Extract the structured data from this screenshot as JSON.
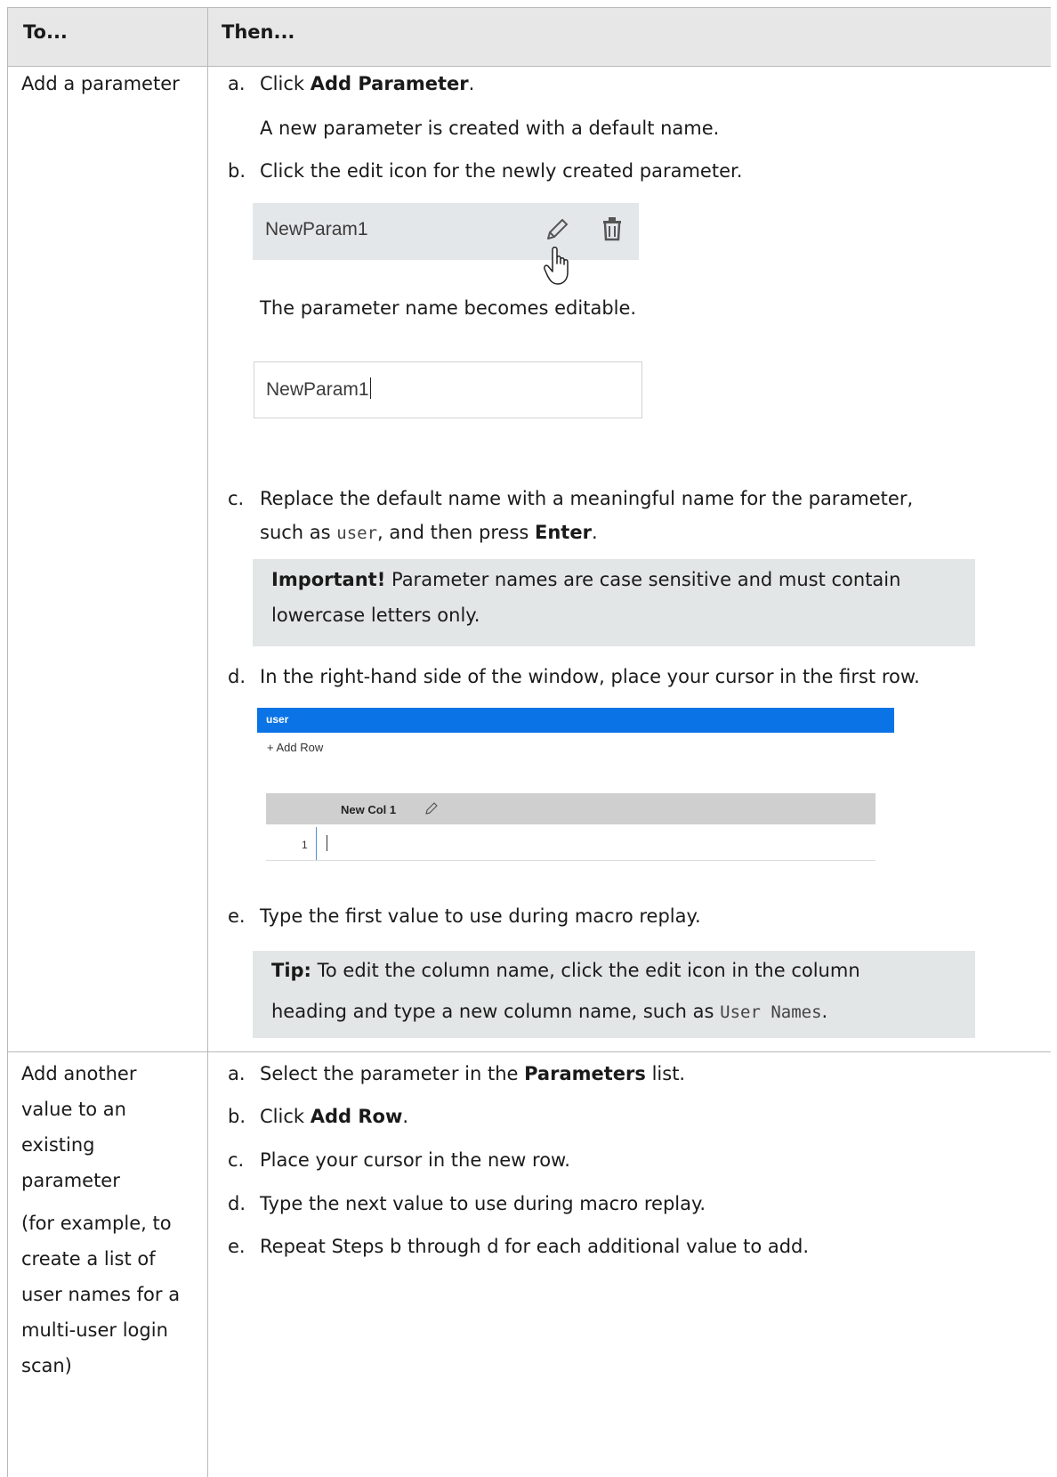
{
  "header": {
    "col1": "To...",
    "col2": "Then..."
  },
  "row1": {
    "task": "Add a parameter",
    "steps": {
      "a_marker": "a.",
      "a_pre": "Click ",
      "a_bold": "Add Parameter",
      "a_post": ".",
      "a_result": "A new parameter is created with a default name.",
      "b_marker": "b.",
      "b_text": "Click the edit icon for the newly created parameter.",
      "b_result": "The parameter name becomes editable.",
      "c_marker": "c.",
      "c_line1": "Replace the default name with a meaningful name for the parameter,",
      "c_pre": "such as ",
      "c_code": "user",
      "c_mid": ", and then press ",
      "c_bold": "Enter",
      "c_post": ".",
      "important_label": "Important!",
      "important_line1": " Parameter names are case sensitive and must contain",
      "important_line2": "lowercase letters only.",
      "d_marker": "d.",
      "d_text": "In the right-hand side of the window, place your cursor in the first row.",
      "e_marker": "e.",
      "e_text": "Type the first value to use during macro replay.",
      "tip_label": "Tip:",
      "tip_line1": " To edit the column name, click the edit icon in the column",
      "tip_pre": "heading and type a new column name, such as ",
      "tip_code": "User Names",
      "tip_post": "."
    },
    "widget1": {
      "param_name": "NewParam1",
      "icons": [
        "pencil-icon",
        "trash-icon",
        "hand-cursor-icon"
      ]
    },
    "widget2": {
      "param_name": "NewParam1"
    },
    "widget3": {
      "tab_label": "user",
      "add_row_label": "+ Add Row",
      "column_label": "New Col 1",
      "row_number": "1"
    }
  },
  "row2": {
    "task_lines": [
      "Add another",
      "value to an",
      "existing",
      "parameter"
    ],
    "example_lines": [
      "(for example, to",
      "create a list of",
      "user names for a",
      "multi-user login",
      "scan)"
    ],
    "steps": {
      "a_marker": "a.",
      "a_pre": "Select the parameter in the ",
      "a_bold": "Parameters",
      "a_post": " list.",
      "b_marker": "b.",
      "b_pre": "Click ",
      "b_bold": "Add Row",
      "b_post": ".",
      "c_marker": "c.",
      "c_text": "Place your cursor in the new row.",
      "d_marker": "d.",
      "d_text": "Type the next value to use during macro replay.",
      "e_marker": "e.",
      "e_text": "Repeat Steps b through d for each additional value to add."
    }
  }
}
